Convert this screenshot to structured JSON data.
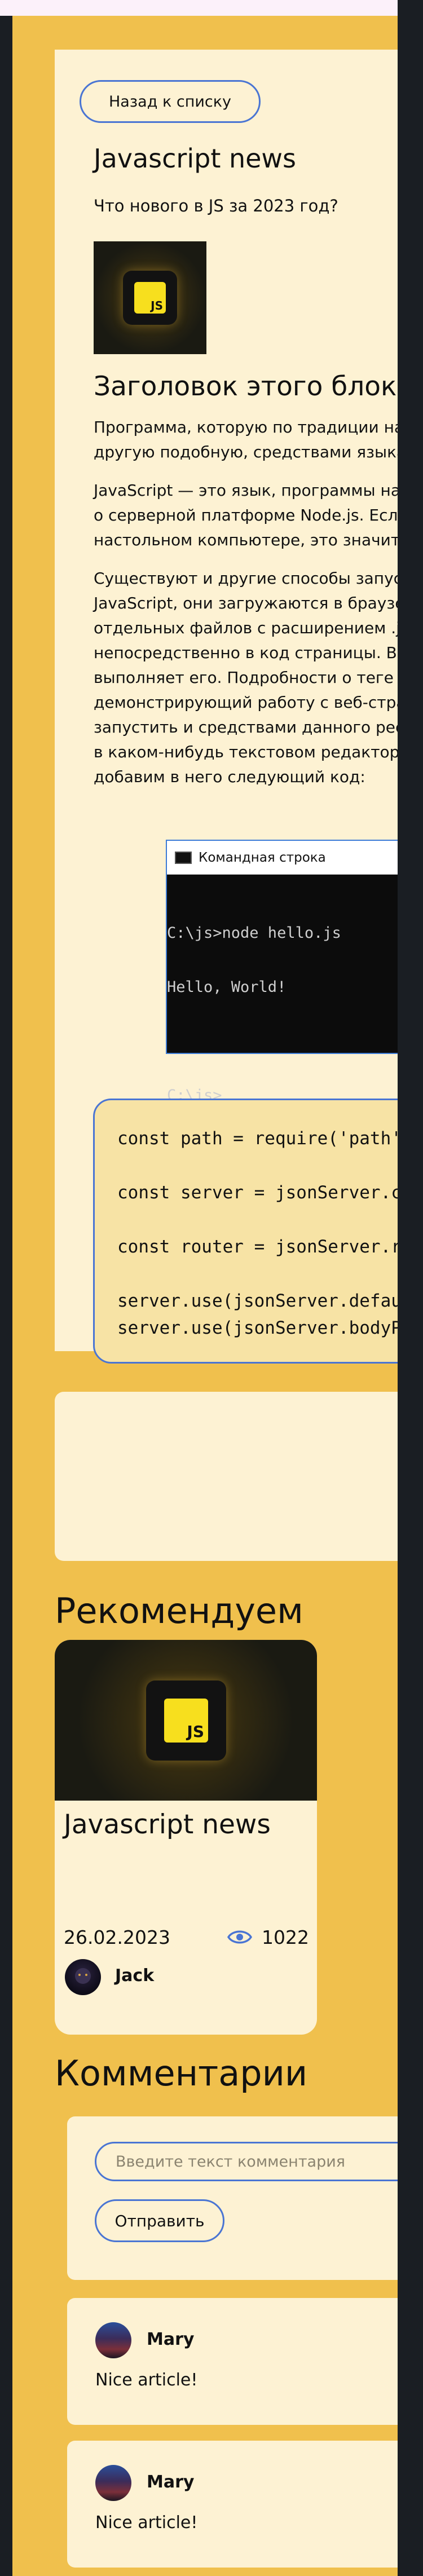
{
  "article": {
    "back_label": "Назад к списку",
    "title": "Javascript news",
    "subtitle": "Что нового в JS за 2023 год?",
    "logo_text": "JS",
    "block_title": "Заголовок этого блока",
    "paragraphs": [
      [
        "Программа, которую по традиции называют «Hello, world!», очень проста. Она выводит куда-либо фразу «Hello, world!», или другую подобную,",
        "другую подобную, средствами языка."
      ],
      [
        "JavaScript — это язык, программы на котором можно выполнять в разных средах. В нашем случае речь идёт о браузерах и",
        "о серверной платформе Node.js. Если до сих пор вы не написали ни строчки кода на JS и читаете этот текст в браузере, на",
        "настольном компьютере, это значит, что вы буквально в считанных секундах от своей первой JavaScript-программы."
      ],
      [
        "Существуют и другие способы запуска JS-кода в браузере. Так, если говорить об обычном использовании программ на",
        "JavaScript, они загружаются в браузер для обеспечения работы веб-страниц. Как правило, код оформляют в виде",
        "отдельных файлов с расширением .js, которые подключают к веб-страницам, но программный код можно включать и",
        "непосредственно в код страницы. Всё это делается с помощью тега script. Когда браузер обнаруживает такой код, он",
        "выполняет его. Подробности о теге script можно посмотреть на сайте w3school.com. В частности, рассмотрим пример,",
        "демонстрирующий работу с веб-страницей средствами JavaScript, приведённый на этом ресурсе. Этот пример можно",
        "запустить и средствами данного ресурса (ищите кнопку Try it Yourself), но мы поступим немного иначе. А именно, создадим",
        "в каком-нибудь текстовом редакторе (например — в VS Code или в Notepad++) новый файл, который назовём hello.html, и",
        "добавим в него следующий код:"
      ]
    ],
    "cmd": {
      "title": "Командная строка",
      "lines": [
        "C:\\js>node hello.js",
        "Hello, World!",
        "",
        "C:\\js>"
      ]
    },
    "code": "const path = require('path');\n\nconst server = jsonServer.create();\n\nconst router = jsonServer.router(path.resolve(__dirname, 'db.json'));\n\nserver.use(jsonServer.defaults({}));\nserver.use(jsonServer.bodyParser);"
  },
  "recommend": {
    "heading": "Рекомендуем",
    "card": {
      "title": "Javascript news",
      "date": "26.02.2023",
      "views": "1022",
      "author": "Jack",
      "logo_text": "JS",
      "views_icon": "eye-icon"
    }
  },
  "comments": {
    "heading": "Комментарии",
    "input_placeholder": "Введите текст комментария",
    "send_label": "Отправить",
    "items": [
      {
        "author": "Mary",
        "text": "Nice article!"
      },
      {
        "author": "Mary",
        "text": "Nice article!"
      }
    ]
  },
  "colors": {
    "page_bg": "#f0c04d",
    "card_bg": "#fdf2d3",
    "accent": "#4a75d3",
    "dark": "#1a1e23"
  }
}
